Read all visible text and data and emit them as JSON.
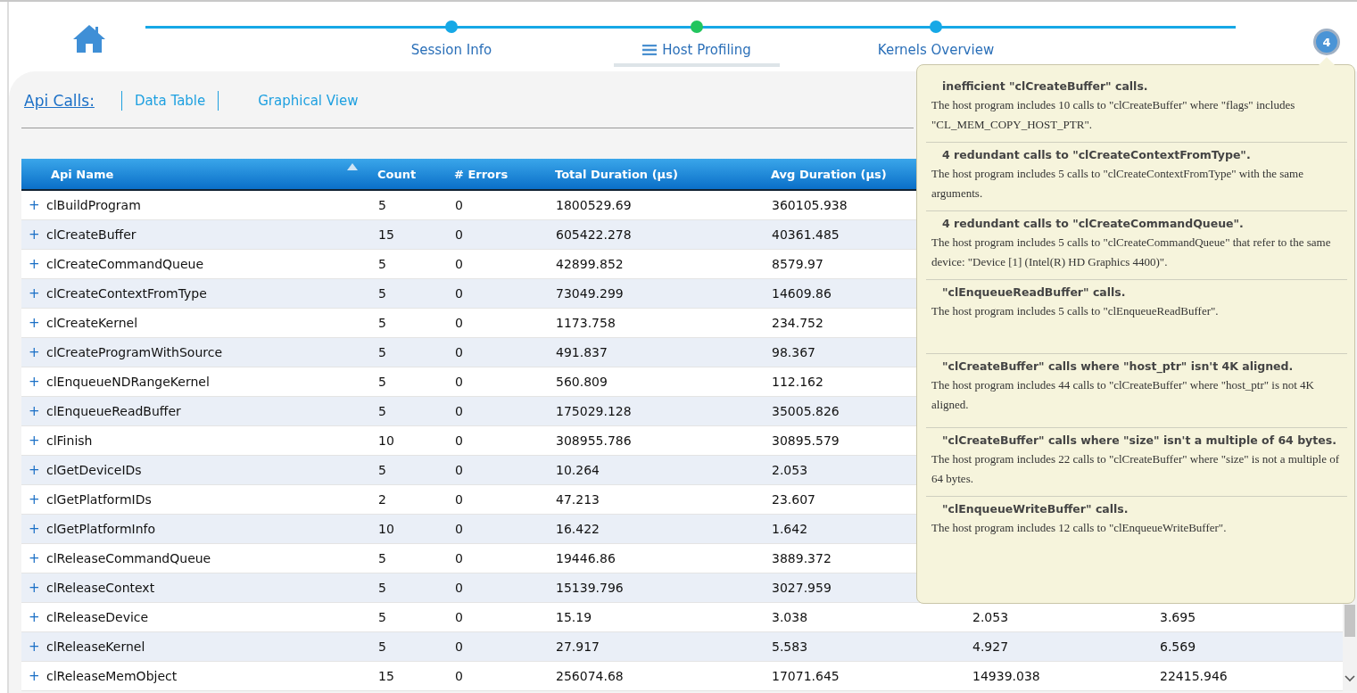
{
  "steps": [
    {
      "label": "Session Info",
      "selected": false
    },
    {
      "label": "Host Profiling",
      "selected": true
    },
    {
      "label": "Kernels Overview",
      "selected": false
    }
  ],
  "notification_badge": "4",
  "section": {
    "title": "Api Calls:",
    "views": [
      {
        "label": "Data Table",
        "selected": true
      },
      {
        "label": "Graphical View",
        "selected": false
      }
    ]
  },
  "table": {
    "columns": [
      {
        "label": "Api Name",
        "sorted": true
      },
      {
        "label": "Count",
        "sorted": false
      },
      {
        "label": "# Errors",
        "sorted": false
      },
      {
        "label": "Total Duration (µs)",
        "sorted": false
      },
      {
        "label": "Avg Duration (µs)",
        "sorted": false
      }
    ],
    "rows": [
      {
        "expander": "+",
        "cells": [
          "clBuildProgram",
          "5",
          "0",
          "1800529.69",
          "360105.938"
        ]
      },
      {
        "expander": "+",
        "cells": [
          "clCreateBuffer",
          "15",
          "0",
          "605422.278",
          "40361.485"
        ]
      },
      {
        "expander": "+",
        "cells": [
          "clCreateCommandQueue",
          "5",
          "0",
          "42899.852",
          "8579.97"
        ]
      },
      {
        "expander": "+",
        "cells": [
          "clCreateContextFromType",
          "5",
          "0",
          "73049.299",
          "14609.86"
        ]
      },
      {
        "expander": "+",
        "cells": [
          "clCreateKernel",
          "5",
          "0",
          "1173.758",
          "234.752"
        ]
      },
      {
        "expander": "+",
        "cells": [
          "clCreateProgramWithSource",
          "5",
          "0",
          "491.837",
          "98.367"
        ]
      },
      {
        "expander": "+",
        "cells": [
          "clEnqueueNDRangeKernel",
          "5",
          "0",
          "560.809",
          "112.162"
        ]
      },
      {
        "expander": "+",
        "cells": [
          "clEnqueueReadBuffer",
          "5",
          "0",
          "175029.128",
          "35005.826"
        ]
      },
      {
        "expander": "+",
        "cells": [
          "clFinish",
          "10",
          "0",
          "308955.786",
          "30895.579"
        ]
      },
      {
        "expander": "+",
        "cells": [
          "clGetDeviceIDs",
          "5",
          "0",
          "10.264",
          "2.053"
        ]
      },
      {
        "expander": "+",
        "cells": [
          "clGetPlatformIDs",
          "2",
          "0",
          "47.213",
          "23.607"
        ]
      },
      {
        "expander": "+",
        "cells": [
          "clGetPlatformInfo",
          "10",
          "0",
          "16.422",
          "1.642"
        ]
      },
      {
        "expander": "+",
        "cells": [
          "clReleaseCommandQueue",
          "5",
          "0",
          "19446.86",
          "3889.372"
        ]
      },
      {
        "expander": "+",
        "cells": [
          "clReleaseContext",
          "5",
          "0",
          "15139.796",
          "3027.959"
        ]
      },
      {
        "expander": "+",
        "cells": [
          "clReleaseDevice",
          "5",
          "0",
          "15.19",
          "3.038",
          "2.053",
          "3.695"
        ]
      },
      {
        "expander": "+",
        "cells": [
          "clReleaseKernel",
          "5",
          "0",
          "27.917",
          "5.583",
          "4.927",
          "6.569"
        ]
      },
      {
        "expander": "+",
        "cells": [
          "clReleaseMemObject",
          "15",
          "0",
          "256074.68",
          "17071.645",
          "14939.038",
          "22415.946"
        ]
      }
    ]
  },
  "notifications": [
    {
      "title": "inefficient \"clCreateBuffer\" calls.",
      "body": "The host program includes 10 calls to \"clCreateBuffer\" where \"flags\" includes \"CL_MEM_COPY_HOST_PTR\"."
    },
    {
      "title": "4 redundant calls to \"clCreateContextFromType\".",
      "body": "The host program includes 5 calls to \"clCreateContextFromType\" with the same arguments."
    },
    {
      "title": "4 redundant calls to \"clCreateCommandQueue\".",
      "body": "The host program includes 5 calls to \"clCreateCommandQueue\" that refer to the same device: \"Device [1] (Intel(R) HD Graphics 4400)\"."
    },
    {
      "title": "\"clEnqueueReadBuffer\" calls.",
      "body": "The host program includes 5 calls to \"clEnqueueReadBuffer\"."
    },
    {
      "title": "\"clCreateBuffer\" calls where \"host_ptr\" isn't 4K aligned.",
      "body": "The host program includes 44 calls to \"clCreateBuffer\" where \"host_ptr\" is not 4K aligned."
    },
    {
      "title": "\"clCreateBuffer\" calls where \"size\" isn't a multiple of 64 bytes.",
      "body": "The host program includes 22 calls to \"clCreateBuffer\" where \"size\" is not a multiple of 64 bytes."
    },
    {
      "title": "\"clEnqueueWriteBuffer\" calls.",
      "body": "The host program includes 12 calls to \"clEnqueueWriteBuffer\"."
    }
  ]
}
